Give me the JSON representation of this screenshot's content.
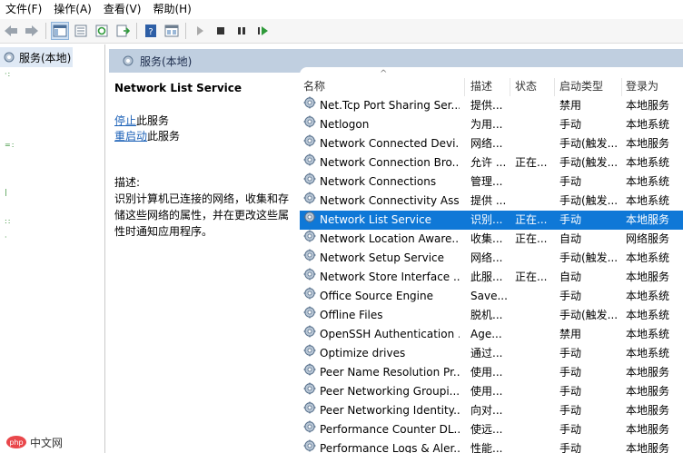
{
  "menu": [
    "文件(F)",
    "操作(A)",
    "查看(V)",
    "帮助(H)"
  ],
  "toolbar_icons": [
    "back-icon",
    "forward-icon",
    "show-hide-tree-icon",
    "properties-icon",
    "refresh-icon",
    "export-list-icon",
    "help-icon",
    "view-icon",
    "start-service-icon",
    "stop-service-icon",
    "pause-service-icon",
    "restart-service-icon"
  ],
  "tree": {
    "label": "服务(本地)"
  },
  "header": {
    "title": "服务(本地)"
  },
  "details": {
    "service_name": "Network List Service",
    "stop_link": "停止",
    "stop_suffix": "此服务",
    "restart_link": "重启动",
    "restart_suffix": "此服务",
    "desc_label": "描述:",
    "desc_text": "识别计算机已连接的网络，收集和存储这些网络的属性，并在更改这些属性时通知应用程序。"
  },
  "columns": [
    "名称",
    "描述",
    "状态",
    "启动类型",
    "登录为"
  ],
  "rows": [
    {
      "name": "Net.Tcp Port Sharing Ser...",
      "desc": "提供...",
      "status": "",
      "start": "禁用",
      "logon": "本地服务"
    },
    {
      "name": "Netlogon",
      "desc": "为用...",
      "status": "",
      "start": "手动",
      "logon": "本地系统"
    },
    {
      "name": "Network Connected Devi...",
      "desc": "网络...",
      "status": "",
      "start": "手动(触发...",
      "logon": "本地服务"
    },
    {
      "name": "Network Connection Bro...",
      "desc": "允许 ...",
      "status": "正在...",
      "start": "手动(触发...",
      "logon": "本地系统"
    },
    {
      "name": "Network Connections",
      "desc": "管理...",
      "status": "",
      "start": "手动",
      "logon": "本地系统"
    },
    {
      "name": "Network Connectivity Ass...",
      "desc": "提供 ...",
      "status": "",
      "start": "手动(触发...",
      "logon": "本地系统"
    },
    {
      "name": "Network List Service",
      "desc": "识别...",
      "status": "正在...",
      "start": "手动",
      "logon": "本地服务",
      "selected": true
    },
    {
      "name": "Network Location Aware...",
      "desc": "收集...",
      "status": "正在...",
      "start": "自动",
      "logon": "网络服务"
    },
    {
      "name": "Network Setup Service",
      "desc": "网络...",
      "status": "",
      "start": "手动(触发...",
      "logon": "本地系统"
    },
    {
      "name": "Network Store Interface ...",
      "desc": "此服...",
      "status": "正在...",
      "start": "自动",
      "logon": "本地服务"
    },
    {
      "name": "Office  Source Engine",
      "desc": "Save...",
      "status": "",
      "start": "手动",
      "logon": "本地系统"
    },
    {
      "name": "Offline Files",
      "desc": "脱机...",
      "status": "",
      "start": "手动(触发...",
      "logon": "本地系统"
    },
    {
      "name": "OpenSSH Authentication ...",
      "desc": "Age...",
      "status": "",
      "start": "禁用",
      "logon": "本地系统"
    },
    {
      "name": "Optimize drives",
      "desc": "通过...",
      "status": "",
      "start": "手动",
      "logon": "本地系统"
    },
    {
      "name": "Peer Name Resolution Pr...",
      "desc": "使用...",
      "status": "",
      "start": "手动",
      "logon": "本地服务"
    },
    {
      "name": "Peer Networking Groupi...",
      "desc": "使用...",
      "status": "",
      "start": "手动",
      "logon": "本地服务"
    },
    {
      "name": "Peer Networking Identity...",
      "desc": "向对...",
      "status": "",
      "start": "手动",
      "logon": "本地服务"
    },
    {
      "name": "Performance Counter DL...",
      "desc": "使远...",
      "status": "",
      "start": "手动",
      "logon": "本地服务"
    },
    {
      "name": "Performance Logs & Aler...",
      "desc": "性能...",
      "status": "",
      "start": "手动",
      "logon": "本地服务"
    }
  ],
  "watermark": {
    "brand": "php",
    "suffix": "中文网"
  },
  "colors": {
    "selected": "#0f78d7",
    "link": "#1d62b8",
    "header_band": "#c0cfe0",
    "tree_selected": "#dfe9f5"
  }
}
